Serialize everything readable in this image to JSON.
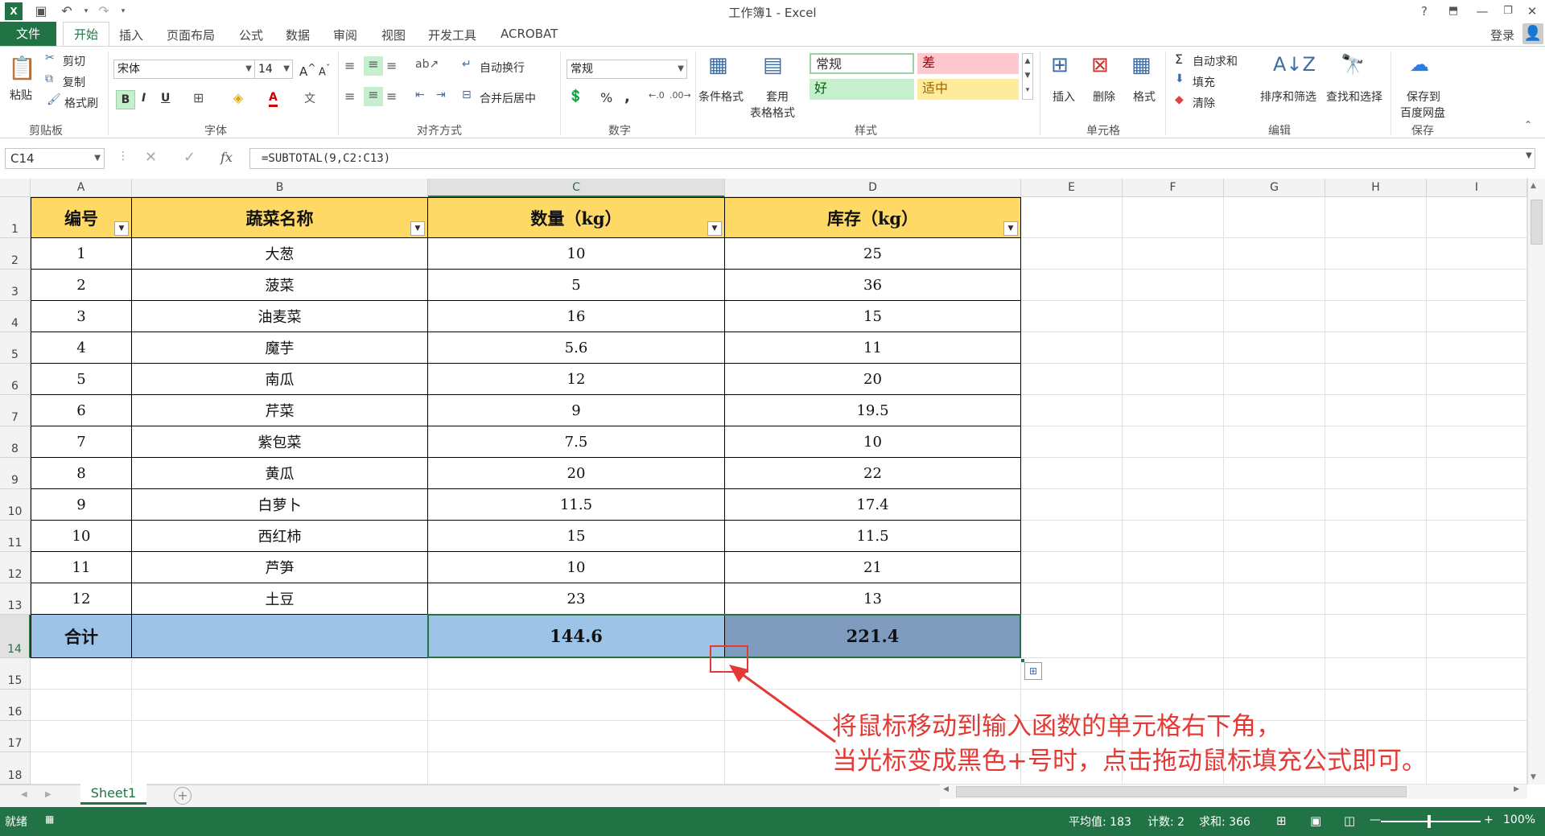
{
  "window": {
    "title": "工作簿1 - Excel",
    "help": "?",
    "signin": "登录"
  },
  "tabs": [
    "文件",
    "开始",
    "插入",
    "页面布局",
    "公式",
    "数据",
    "审阅",
    "视图",
    "开发工具",
    "ACROBAT"
  ],
  "ribbon": {
    "clipboard": {
      "paste": "粘贴",
      "cut": "剪切",
      "copy": "复制",
      "format_painter": "格式刷",
      "label": "剪贴板"
    },
    "font": {
      "name": "宋体",
      "size": "14",
      "bold": "B",
      "italic": "I",
      "underline": "U",
      "label": "字体"
    },
    "alignment": {
      "wrap": "自动换行",
      "merge": "合并后居中",
      "label": "对齐方式"
    },
    "number": {
      "format": "常规",
      "percent": "%",
      "comma": ",",
      "label": "数字"
    },
    "styles": {
      "conditional": "条件格式",
      "table_line1": "套用",
      "table_line2": "表格格式",
      "normal": "常规",
      "bad": "差",
      "good": "好",
      "neutral": "适中",
      "label": "样式"
    },
    "cells": {
      "insert": "插入",
      "delete": "删除",
      "format": "格式",
      "label": "单元格"
    },
    "editing": {
      "autosum": "自动求和",
      "fill": "填充",
      "clear": "清除",
      "sort": "排序和筛选",
      "find": "查找和选择",
      "label": "编辑"
    },
    "save": {
      "line1": "保存到",
      "line2": "百度网盘",
      "label": "保存"
    }
  },
  "formula_bar": {
    "name_box": "C14",
    "fx": "fx",
    "formula": "=SUBTOTAL(9,C2:C13)"
  },
  "columns": [
    "A",
    "B",
    "C",
    "D",
    "E",
    "F",
    "G",
    "H",
    "I"
  ],
  "rows": [
    "1",
    "2",
    "3",
    "4",
    "5",
    "6",
    "7",
    "8",
    "9",
    "10",
    "11",
    "12",
    "13",
    "14",
    "15",
    "16",
    "17",
    "18"
  ],
  "table": {
    "headers": [
      "编号",
      "蔬菜名称",
      "数量（kg）",
      "库存（kg）"
    ],
    "rows": [
      [
        "1",
        "大葱",
        "10",
        "25"
      ],
      [
        "2",
        "菠菜",
        "5",
        "36"
      ],
      [
        "3",
        "油麦菜",
        "16",
        "15"
      ],
      [
        "4",
        "魔芋",
        "5.6",
        "11"
      ],
      [
        "5",
        "南瓜",
        "12",
        "20"
      ],
      [
        "6",
        "芹菜",
        "9",
        "19.5"
      ],
      [
        "7",
        "紫包菜",
        "7.5",
        "10"
      ],
      [
        "8",
        "黄瓜",
        "20",
        "22"
      ],
      [
        "9",
        "白萝卜",
        "11.5",
        "17.4"
      ],
      [
        "10",
        "西红柿",
        "15",
        "11.5"
      ],
      [
        "11",
        "芦笋",
        "10",
        "21"
      ],
      [
        "12",
        "土豆",
        "23",
        "13"
      ]
    ],
    "total": [
      "合计",
      "",
      "144.6",
      "221.4"
    ]
  },
  "sheet_tab": "Sheet1",
  "status": {
    "ready": "就绪",
    "average": "平均值: 183",
    "count": "计数: 2",
    "sum": "求和: 366",
    "zoom": "100%"
  },
  "annotation": {
    "line1": "将鼠标移动到输入函数的单元格右下角，",
    "line2": "当光标变成黑色+号时，点击拖动鼠标填充公式即可。"
  },
  "colors": {
    "excel_green": "#217346",
    "header_fill": "#ffd966",
    "total_fill": "#9dc3e6",
    "annotation": "#e53935"
  }
}
